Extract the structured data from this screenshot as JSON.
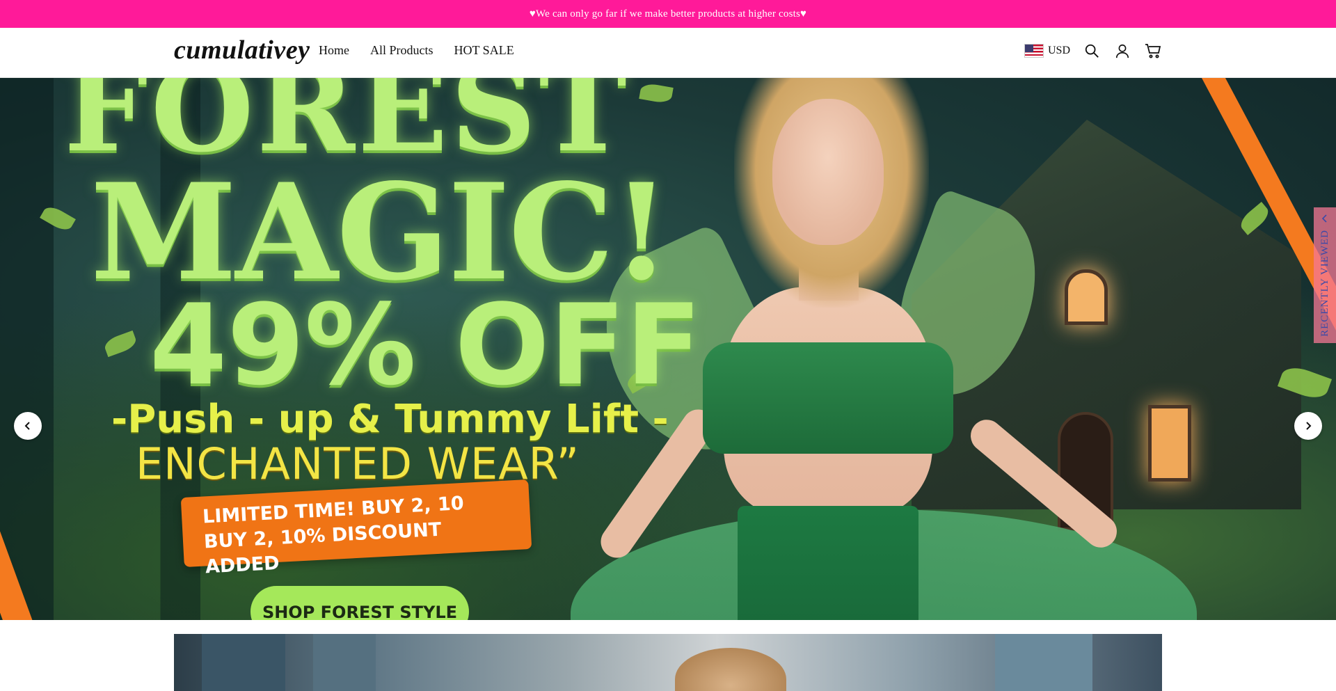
{
  "announcement": {
    "text": "♥We can only go far if we make better products at higher costs♥"
  },
  "header": {
    "logo": "cumulativey",
    "nav": [
      "Home",
      "All Products",
      "HOT SALE"
    ],
    "currency": "USD",
    "icons": [
      "us-flag-icon",
      "search-icon",
      "account-icon",
      "cart-icon"
    ]
  },
  "hero": {
    "line1": "FOREST",
    "line2": "MAGIC!",
    "line3": "49% OFF",
    "line4": "-Push - up & Tummy Lift -",
    "line5": "ENCHANTED WEAR”",
    "promo_line1": "LIMITED TIME!  BUY  2,  10",
    "promo_line2": "BUY 2, 10% DISCOUNT ADDED",
    "cta": "SHOP FOREST STYLE"
  },
  "recently_viewed": {
    "label": "RECENTLY VIEWED"
  },
  "colors": {
    "announcement_bg": "#ff1a99",
    "hero_text_green": "#b9ef7a",
    "hero_text_yellow": "#f3e545",
    "promo_orange": "#f07415",
    "cta_green": "#a5e85a"
  }
}
